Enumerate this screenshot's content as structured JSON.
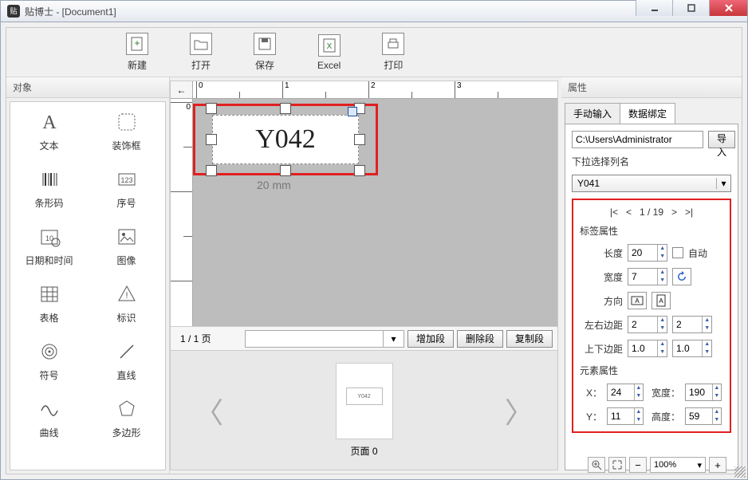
{
  "window": {
    "title": "贴博士 - [Document1]"
  },
  "toolbar": [
    {
      "key": "new",
      "label": "新建"
    },
    {
      "key": "open",
      "label": "打开"
    },
    {
      "key": "save",
      "label": "保存"
    },
    {
      "key": "excel",
      "label": "Excel"
    },
    {
      "key": "print",
      "label": "打印"
    }
  ],
  "left_panel": {
    "title": "对象",
    "items": [
      {
        "key": "text",
        "label": "文本"
      },
      {
        "key": "frame",
        "label": "装饰框"
      },
      {
        "key": "barcode",
        "label": "条形码"
      },
      {
        "key": "serial",
        "label": "序号"
      },
      {
        "key": "datetime",
        "label": "日期和时间"
      },
      {
        "key": "image",
        "label": "图像"
      },
      {
        "key": "table",
        "label": "表格"
      },
      {
        "key": "sign",
        "label": "标识"
      },
      {
        "key": "symbol",
        "label": "符号"
      },
      {
        "key": "line",
        "label": "直线"
      },
      {
        "key": "curve",
        "label": "曲线"
      },
      {
        "key": "polygon",
        "label": "多边形"
      }
    ]
  },
  "canvas": {
    "selected_text": "Y042",
    "dim_label": "20 mm"
  },
  "page_strip": {
    "indicator": "1 / 1 页",
    "add": "增加段",
    "del": "删除段",
    "copy": "复制段"
  },
  "thumb": {
    "caption": "页面 0",
    "sample": "Y042"
  },
  "right_panel": {
    "title": "属性",
    "tabs": {
      "manual": "手动输入",
      "binding": "数据绑定"
    },
    "active_tab": "binding",
    "path": "C:\\Users\\Administrator",
    "import_btn": "导入",
    "column_select_label": "下拉选择列名",
    "column_select_value": "Y041",
    "pager": {
      "first": "|<",
      "prev": "<",
      "pos": "1 / 19",
      "next": ">",
      "last": ">|"
    },
    "label_props_title": "标签属性",
    "length_label": "长度",
    "length": "20",
    "auto_label": "自动",
    "width_label": "宽度",
    "width": "7",
    "orient_label": "方向",
    "lr_margin_label": "左右边距",
    "lr_left": "2",
    "lr_right": "2",
    "tb_margin_label": "上下边距",
    "tb_top": "1.0",
    "tb_bottom": "1.0",
    "elem_props_title": "元素属性",
    "x_label": "X：",
    "x": "24",
    "y_label": "Y：",
    "y": "11",
    "ew_label": "宽度：",
    "ew": "190",
    "eh_label": "高度：",
    "eh": "59"
  },
  "status": {
    "zoom": "100%"
  }
}
